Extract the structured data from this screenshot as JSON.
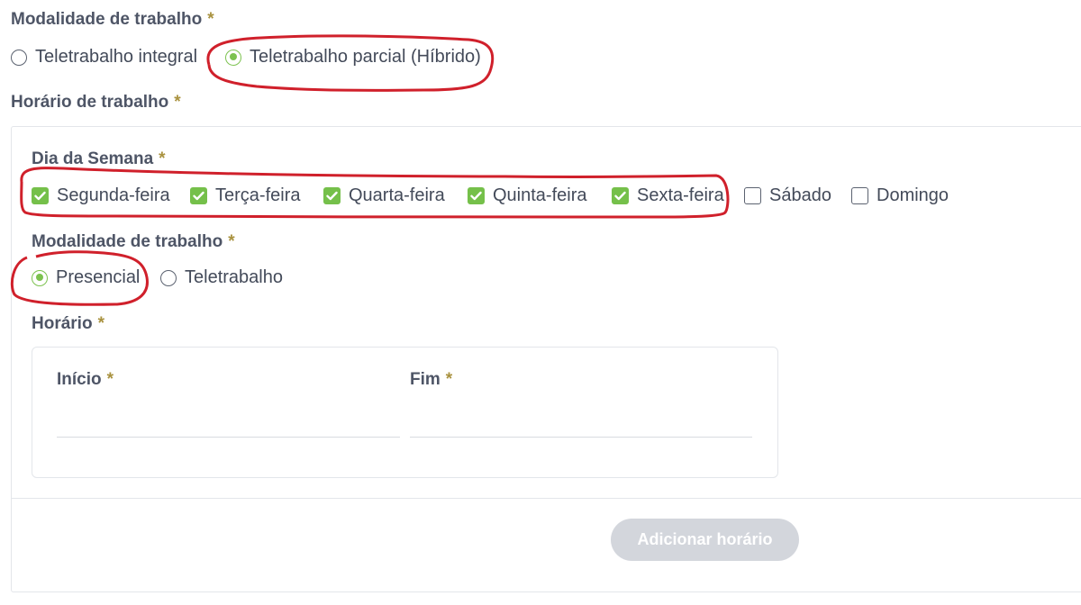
{
  "top_section": {
    "label": "Modalidade de trabalho",
    "required_mark": "*",
    "options": [
      {
        "label": "Teletrabalho integral",
        "selected": false
      },
      {
        "label": "Teletrabalho parcial (Híbrido)",
        "selected": true
      }
    ]
  },
  "schedule": {
    "label": "Horário de trabalho",
    "required_mark": "*",
    "weekdays": {
      "label": "Dia da Semana",
      "required_mark": "*",
      "days": [
        {
          "label": "Segunda-feira",
          "checked": true
        },
        {
          "label": "Terça-feira",
          "checked": true
        },
        {
          "label": "Quarta-feira",
          "checked": true
        },
        {
          "label": "Quinta-feira",
          "checked": true
        },
        {
          "label": "Sexta-feira",
          "checked": true
        },
        {
          "label": "Sábado",
          "checked": false
        },
        {
          "label": "Domingo",
          "checked": false
        }
      ]
    },
    "work_mode": {
      "label": "Modalidade de trabalho",
      "required_mark": "*",
      "options": [
        {
          "label": "Presencial",
          "selected": true
        },
        {
          "label": "Teletrabalho",
          "selected": false
        }
      ]
    },
    "hours": {
      "label": "Horário",
      "required_mark": "*",
      "start_label": "Início",
      "end_label": "Fim",
      "start_value": "",
      "end_value": ""
    },
    "add_button_label": "Adicionar horário"
  },
  "colors": {
    "accent_green": "#75c04a",
    "required_mark": "#a9923f",
    "annotation_red": "#d0202b",
    "button_disabled": "#d3d6dc"
  }
}
